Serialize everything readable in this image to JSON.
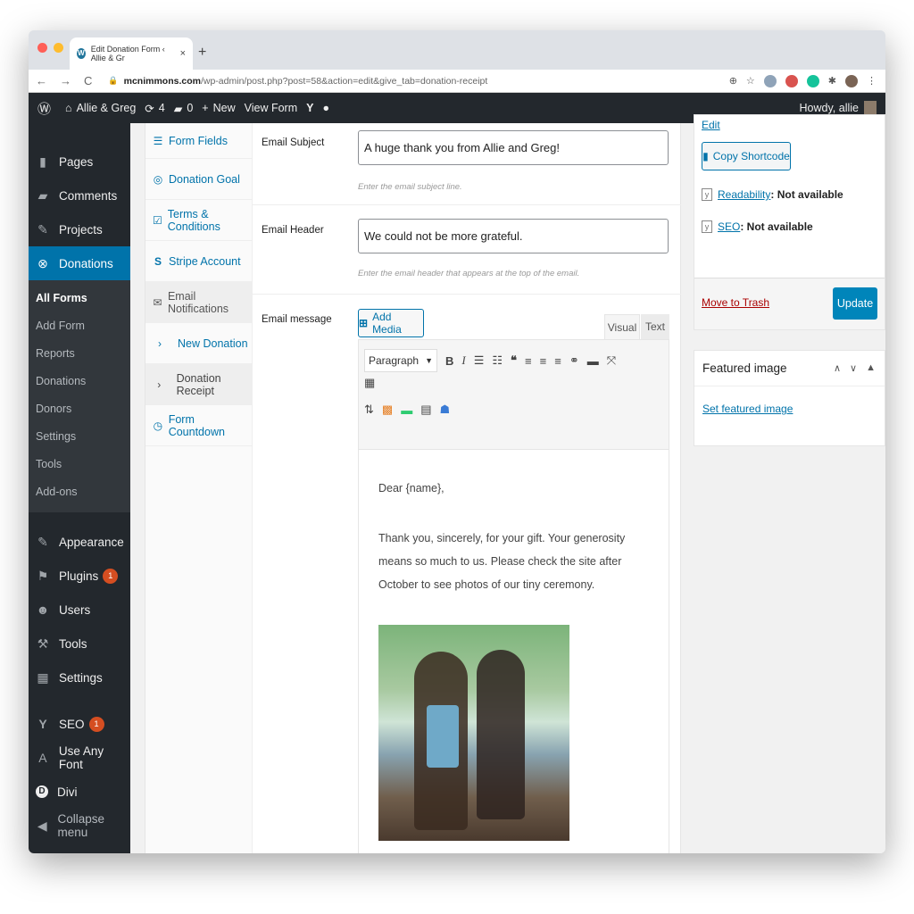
{
  "browser": {
    "tab_title": "Edit Donation Form ‹ Allie & Gr",
    "tab_close": "×",
    "new_tab": "+",
    "url_host": "mcnimmons.com",
    "url_path": "/wp-admin/post.php?post=58&action=edit&give_tab=donation-receipt",
    "nav_back": "←",
    "nav_forward": "→",
    "nav_reload": "C"
  },
  "adminbar": {
    "site_name": "Allie & Greg",
    "updates_count": "4",
    "comments_count": "0",
    "new_label": "New",
    "view_label": "View Form",
    "howdy": "Howdy, allie"
  },
  "sidebar": {
    "items_top": [
      {
        "label": "Pages",
        "icon": "▮"
      },
      {
        "label": "Comments",
        "icon": "▰"
      },
      {
        "label": "Projects",
        "icon": "✎"
      }
    ],
    "active": {
      "label": "Donations",
      "icon": "⊗"
    },
    "submenu": [
      "All Forms",
      "Add Form",
      "Reports",
      "Donations",
      "Donors",
      "Settings",
      "Tools",
      "Add-ons"
    ],
    "items_bottom": [
      {
        "label": "Appearance",
        "icon": "✎"
      },
      {
        "label": "Plugins",
        "icon": "⚑",
        "badge": "1"
      },
      {
        "label": "Users",
        "icon": "☻"
      },
      {
        "label": "Tools",
        "icon": "⚒"
      },
      {
        "label": "Settings",
        "icon": "▦"
      }
    ],
    "items_extra": [
      {
        "label": "SEO",
        "icon": "Y",
        "badge": "1"
      },
      {
        "label": "Use Any Font",
        "icon": "A"
      },
      {
        "label": "Divi",
        "icon": "D"
      },
      {
        "label": "Collapse menu",
        "icon": "◀"
      }
    ]
  },
  "form_tabs": {
    "items": [
      {
        "label": "Form Fields",
        "icon": "☰"
      },
      {
        "label": "Donation Goal",
        "icon": "◎"
      },
      {
        "label": "Terms & Conditions",
        "icon": "☑"
      },
      {
        "label": "Stripe Account",
        "icon": "S"
      },
      {
        "label": "Email Notifications",
        "icon": "✉"
      }
    ],
    "sub": [
      {
        "label": "New Donation",
        "icon": "›"
      },
      {
        "label": "Donation Receipt",
        "icon": "›"
      }
    ],
    "after": {
      "label": "Form Countdown",
      "icon": "◷"
    }
  },
  "fields": {
    "subject": {
      "label": "Email Subject",
      "value": "A huge thank you from Allie and Greg!",
      "desc": "Enter the email subject line."
    },
    "header": {
      "label": "Email Header",
      "value": "We could not be more grateful.",
      "desc": "Enter the email header that appears at the top of the email."
    },
    "message": {
      "label": "Email message",
      "add_media": "Add Media",
      "visual": "Visual",
      "text": "Text",
      "format": "Paragraph",
      "para1": "Dear {name},",
      "para2": "Thank you, sincerely, for your gift. Your generosity means so much to us. Please check the site after October to see photos of our tiny ceremony."
    }
  },
  "publish": {
    "edit": "Edit",
    "shortcode": "Copy Shortcode",
    "readability_link": "Readability",
    "readability_value": ": Not available",
    "seo_link": "SEO",
    "seo_value": ": Not available",
    "trash": "Move to Trash",
    "update": "Update"
  },
  "featured": {
    "title": "Featured image",
    "link": "Set featured image"
  },
  "colors": {
    "admin_dark": "#23282d",
    "accent_blue": "#0073aa",
    "update_blue": "#0085ba",
    "badge_orange": "#d54e21"
  }
}
